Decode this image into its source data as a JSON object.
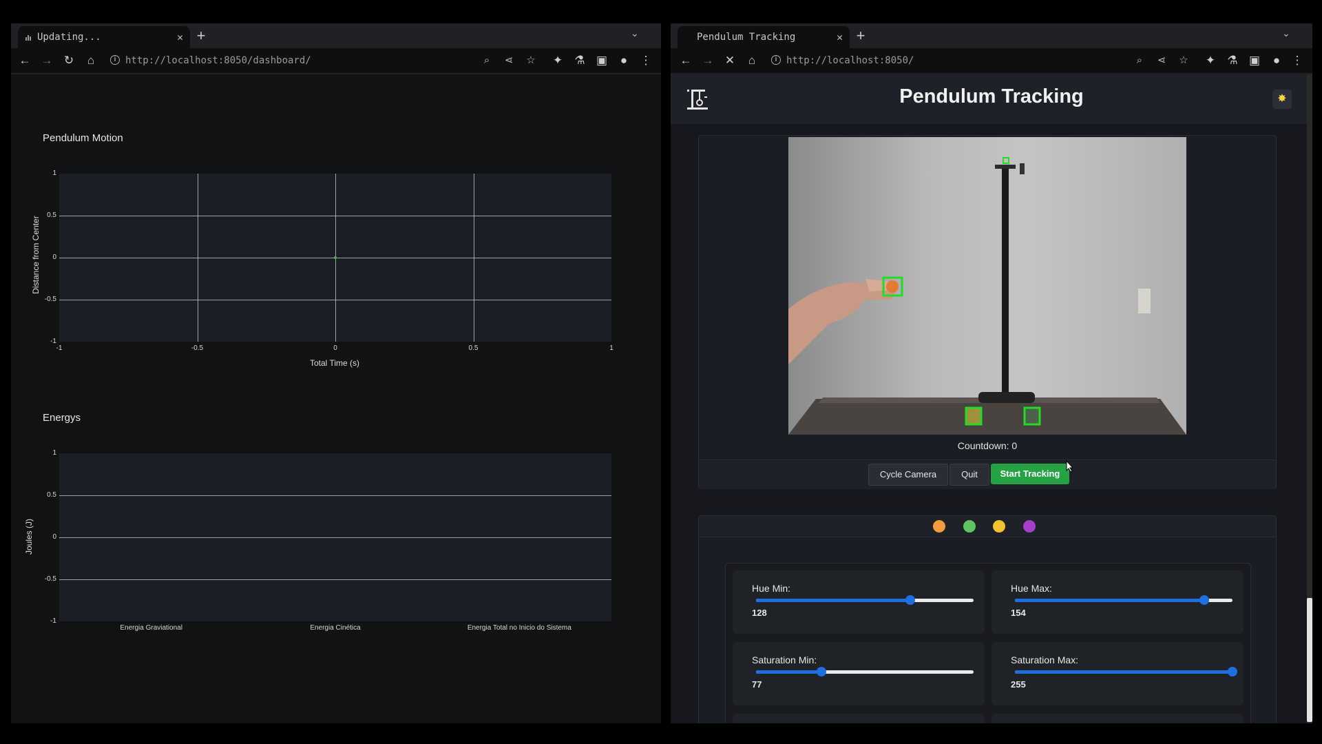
{
  "left_window": {
    "tab_title": "Updating...",
    "url": "http://localhost:8050/dashboard/"
  },
  "right_window": {
    "tab_title": "Pendulum Tracking",
    "url": "http://localhost:8050/"
  },
  "app": {
    "title": "Pendulum Tracking",
    "countdown": "Countdown: 0",
    "buttons": {
      "cycle_camera": "Cycle Camera",
      "quit": "Quit",
      "start_tracking": "Start Tracking"
    },
    "color_dots": [
      "#f39c3d",
      "#5cc460",
      "#f2c230",
      "#a63fc9"
    ],
    "sliders": [
      {
        "label": "Hue Min:",
        "value": "128",
        "fraction": 0.71
      },
      {
        "label": "Hue Max:",
        "value": "154",
        "fraction": 0.87
      },
      {
        "label": "Saturation Min:",
        "value": "77",
        "fraction": 0.3
      },
      {
        "label": "Saturation Max:",
        "value": "255",
        "fraction": 1.0
      }
    ]
  },
  "chart_data": [
    {
      "type": "scatter",
      "title": "Pendulum Motion",
      "xlabel": "Total Time (s)",
      "ylabel": "Distance from Center",
      "xlim": [
        -1,
        1
      ],
      "ylim": [
        -1,
        1
      ],
      "xticks": [
        "-1",
        "-0.5",
        "0",
        "0.5",
        "1"
      ],
      "yticks": [
        "1",
        "0.5",
        "0",
        "-0.5",
        "-1"
      ],
      "x": [
        0
      ],
      "y": [
        0
      ],
      "grid": true
    },
    {
      "type": "bar",
      "title": "Energys",
      "ylabel": "Joules (J)",
      "categories": [
        "Energia Graviational",
        "Energia Cinética",
        "Energia Total no Inicio do Sistema"
      ],
      "values": [],
      "ylim": [
        -1,
        1
      ],
      "yticks": [
        "1",
        "0.5",
        "0",
        "-0.5",
        "-1"
      ],
      "grid": true
    }
  ]
}
